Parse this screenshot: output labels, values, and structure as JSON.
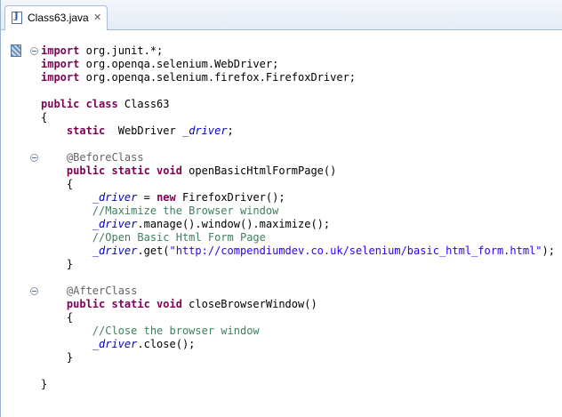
{
  "tab": {
    "title": "Class63.java",
    "close_glyph": "✕",
    "file_icon_letter": "J"
  },
  "colors": {
    "keyword": "#7f0055",
    "field": "#0000c0",
    "annotation": "#646464",
    "comment": "#3f7f5f",
    "string": "#2a00ff"
  },
  "code": {
    "lines": [
      [
        {
          "c": "kw",
          "t": "import"
        },
        {
          "t": " org.junit.*;"
        }
      ],
      [
        {
          "c": "kw",
          "t": "import"
        },
        {
          "t": " org.openqa.selenium.WebDriver;"
        }
      ],
      [
        {
          "c": "kw",
          "t": "import"
        },
        {
          "t": " org.openqa.selenium.firefox.FirefoxDriver;"
        }
      ],
      [],
      [
        {
          "c": "kw",
          "t": "public class"
        },
        {
          "t": " Class63"
        }
      ],
      [
        {
          "t": "{"
        }
      ],
      [
        {
          "t": "    "
        },
        {
          "c": "kw",
          "t": "static"
        },
        {
          "t": "  WebDriver "
        },
        {
          "c": "fld",
          "t": "_driver"
        },
        {
          "t": ";"
        }
      ],
      [],
      [
        {
          "t": "    "
        },
        {
          "c": "ann",
          "t": "@BeforeClass"
        }
      ],
      [
        {
          "t": "    "
        },
        {
          "c": "kw",
          "t": "public static void"
        },
        {
          "t": " openBasicHtmlFormPage()"
        }
      ],
      [
        {
          "t": "    {"
        }
      ],
      [
        {
          "t": "        "
        },
        {
          "c": "fld",
          "t": "_driver"
        },
        {
          "t": " = "
        },
        {
          "c": "kw",
          "t": "new"
        },
        {
          "t": " FirefoxDriver();"
        }
      ],
      [
        {
          "t": "        "
        },
        {
          "c": "cm",
          "t": "//Maximize the Browser window"
        }
      ],
      [
        {
          "t": "        "
        },
        {
          "c": "fld",
          "t": "_driver"
        },
        {
          "t": ".manage().window().maximize();"
        }
      ],
      [
        {
          "t": "        "
        },
        {
          "c": "cm",
          "t": "//Open Basic Html Form Page"
        }
      ],
      [
        {
          "t": "        "
        },
        {
          "c": "fld",
          "t": "_driver"
        },
        {
          "t": ".get("
        },
        {
          "c": "str",
          "t": "\"http://compendiumdev.co.uk/selenium/basic_html_form.html\""
        },
        {
          "t": ");"
        }
      ],
      [
        {
          "t": "    }"
        }
      ],
      [],
      [
        {
          "t": "    "
        },
        {
          "c": "ann",
          "t": "@AfterClass"
        }
      ],
      [
        {
          "t": "    "
        },
        {
          "c": "kw",
          "t": "public static void"
        },
        {
          "t": " closeBrowserWindow()"
        }
      ],
      [
        {
          "t": "    {"
        }
      ],
      [
        {
          "t": "        "
        },
        {
          "c": "cm",
          "t": "//Close the browser window"
        }
      ],
      [
        {
          "t": "        "
        },
        {
          "c": "fld",
          "t": "_driver"
        },
        {
          "t": ".close();"
        }
      ],
      [
        {
          "t": "    }"
        }
      ],
      [],
      [
        {
          "t": "}"
        }
      ]
    ]
  }
}
